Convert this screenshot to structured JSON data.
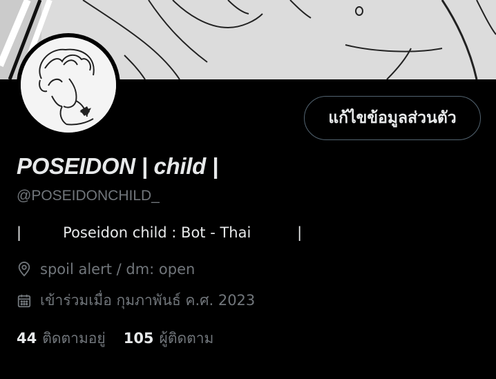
{
  "profile": {
    "edit_button_label": "แก้ไขข้อมูลส่วนตัว",
    "display_name": "POSEIDON | child |",
    "handle": "@POSEIDONCHILD_",
    "bio": "|         Poseidon child : Bot - Thai          |",
    "location": "spoil alert / dm: open",
    "joined": "เข้าร่วมเมื่อ กุมภาพันธ์ ค.ศ. 2023",
    "following_count": "44",
    "following_label": "ติดตามอยู่",
    "followers_count": "105",
    "followers_label": "ผู้ติดตาม"
  },
  "icons": {
    "location": "location-pin-icon",
    "calendar": "calendar-icon"
  },
  "colors": {
    "background": "#000000",
    "text_primary": "#e7e9ea",
    "text_secondary": "#71767b",
    "button_border": "#536471"
  }
}
